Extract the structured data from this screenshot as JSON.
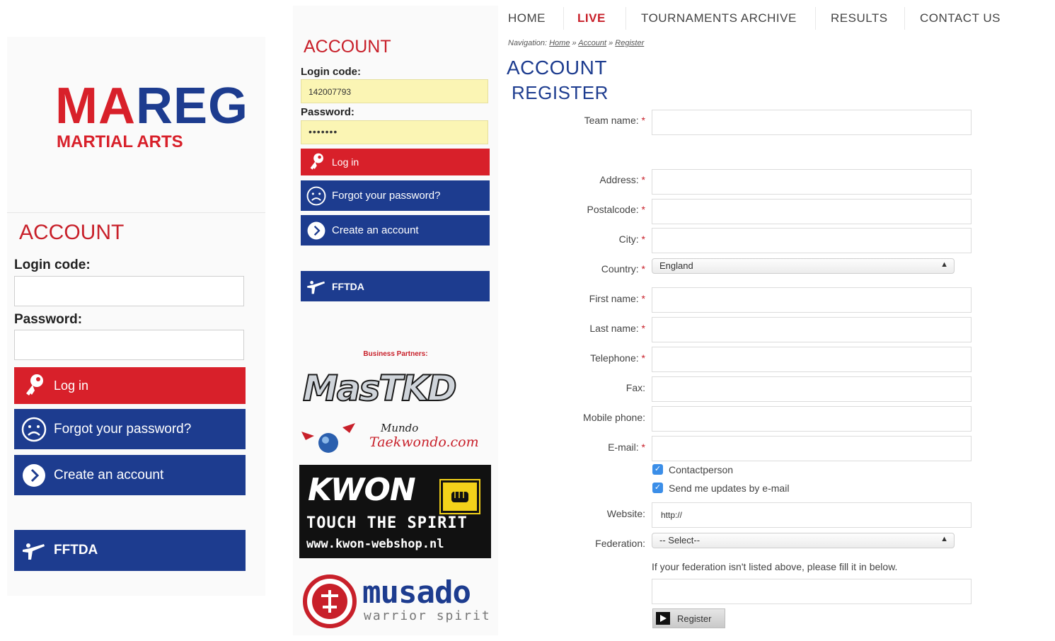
{
  "left": {
    "logo": {
      "part1": "MA",
      "part2": "REG",
      "sub": "MARTIAL ARTS"
    },
    "heading": "ACCOUNT",
    "login_label": "Login code:",
    "password_label": "Password:",
    "login_button": "Log in",
    "forgot_button": "Forgot your password?",
    "create_button": "Create an account",
    "fftda_button": "FFTDA"
  },
  "mid": {
    "heading": "ACCOUNT",
    "login_label": "Login code:",
    "login_value": "142007793",
    "password_label": "Password:",
    "password_value": "•••••••",
    "login_button": "Log in",
    "forgot_button": "Forgot your password?",
    "create_button": "Create an account",
    "fftda_button": "FFTDA",
    "partners_label": "Business Partners:",
    "partners": {
      "mastkd": "MasTKD",
      "mundo1": "Mundo",
      "mundo2": "Taekwondo.com",
      "kwon": "KWON",
      "kwon_tag": "TOUCH THE SPIRIT",
      "kwon_url": "www.kwon-webshop.nl",
      "musado": "musado",
      "musado_sub": "warrior spirit"
    }
  },
  "nav": {
    "home": "HOME",
    "live": "LIVE",
    "archive": "TOURNAMENTS ARCHIVE",
    "results": "RESULTS",
    "contact": "CONTACT US"
  },
  "breadcrumb": {
    "prefix": "Navigation:",
    "home": "Home",
    "account": "Account",
    "register": "Register",
    "sep": "»"
  },
  "title": {
    "line1": "ACCOUNT",
    "line2": "REGISTER"
  },
  "form": {
    "team_name": "Team name:",
    "address": "Address:",
    "postalcode": "Postalcode:",
    "city": "City:",
    "country": "Country:",
    "country_value": "England",
    "first_name": "First name:",
    "last_name": "Last name:",
    "telephone": "Telephone:",
    "fax": "Fax:",
    "mobile": "Mobile phone:",
    "email": "E-mail:",
    "contactperson": "Contactperson",
    "updates": "Send me updates by e-mail",
    "website": "Website:",
    "website_value": "http://",
    "federation": "Federation:",
    "federation_value": "-- Select--",
    "federation_note": "If your federation isn't listed above, please fill it in below.",
    "register_button": "Register",
    "required_mark": "*"
  },
  "colors": {
    "red": "#d8202a",
    "blue": "#1d3c8f",
    "highlight": "#fbf5b4",
    "checkbox": "#3b8ee8"
  }
}
